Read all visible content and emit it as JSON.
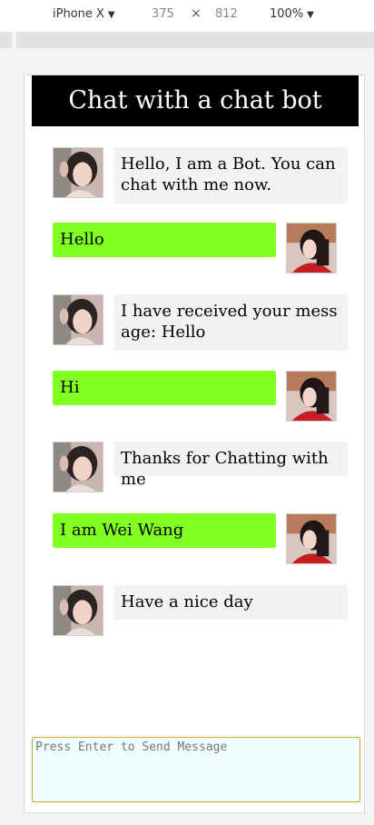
{
  "devtools": {
    "device": "iPhone X",
    "width": "375",
    "times": "×",
    "height": "812",
    "zoom": "100%"
  },
  "app": {
    "title": "Chat with a chat bot",
    "input_placeholder": "Press Enter to Send Message"
  },
  "messages": [
    {
      "from": "bot",
      "text": "Hello, I am a Bot. You can chat with me now."
    },
    {
      "from": "user",
      "text": "Hello"
    },
    {
      "from": "bot",
      "text": "I have received your message: Hello"
    },
    {
      "from": "user",
      "text": "Hi"
    },
    {
      "from": "bot",
      "text": "Thanks for Chatting with me"
    },
    {
      "from": "user",
      "text": "I am Wei Wang"
    },
    {
      "from": "bot",
      "text": "Have a nice day"
    }
  ],
  "colors": {
    "header_bg": "#000000",
    "user_bubble": "#7fff22",
    "bot_bubble": "#f2f2f2",
    "input_bg": "#f0fffe",
    "input_border": "#d8a030"
  },
  "icons": {
    "bot_avatar": "bot-avatar-photo",
    "user_avatar": "user-avatar-photo"
  }
}
